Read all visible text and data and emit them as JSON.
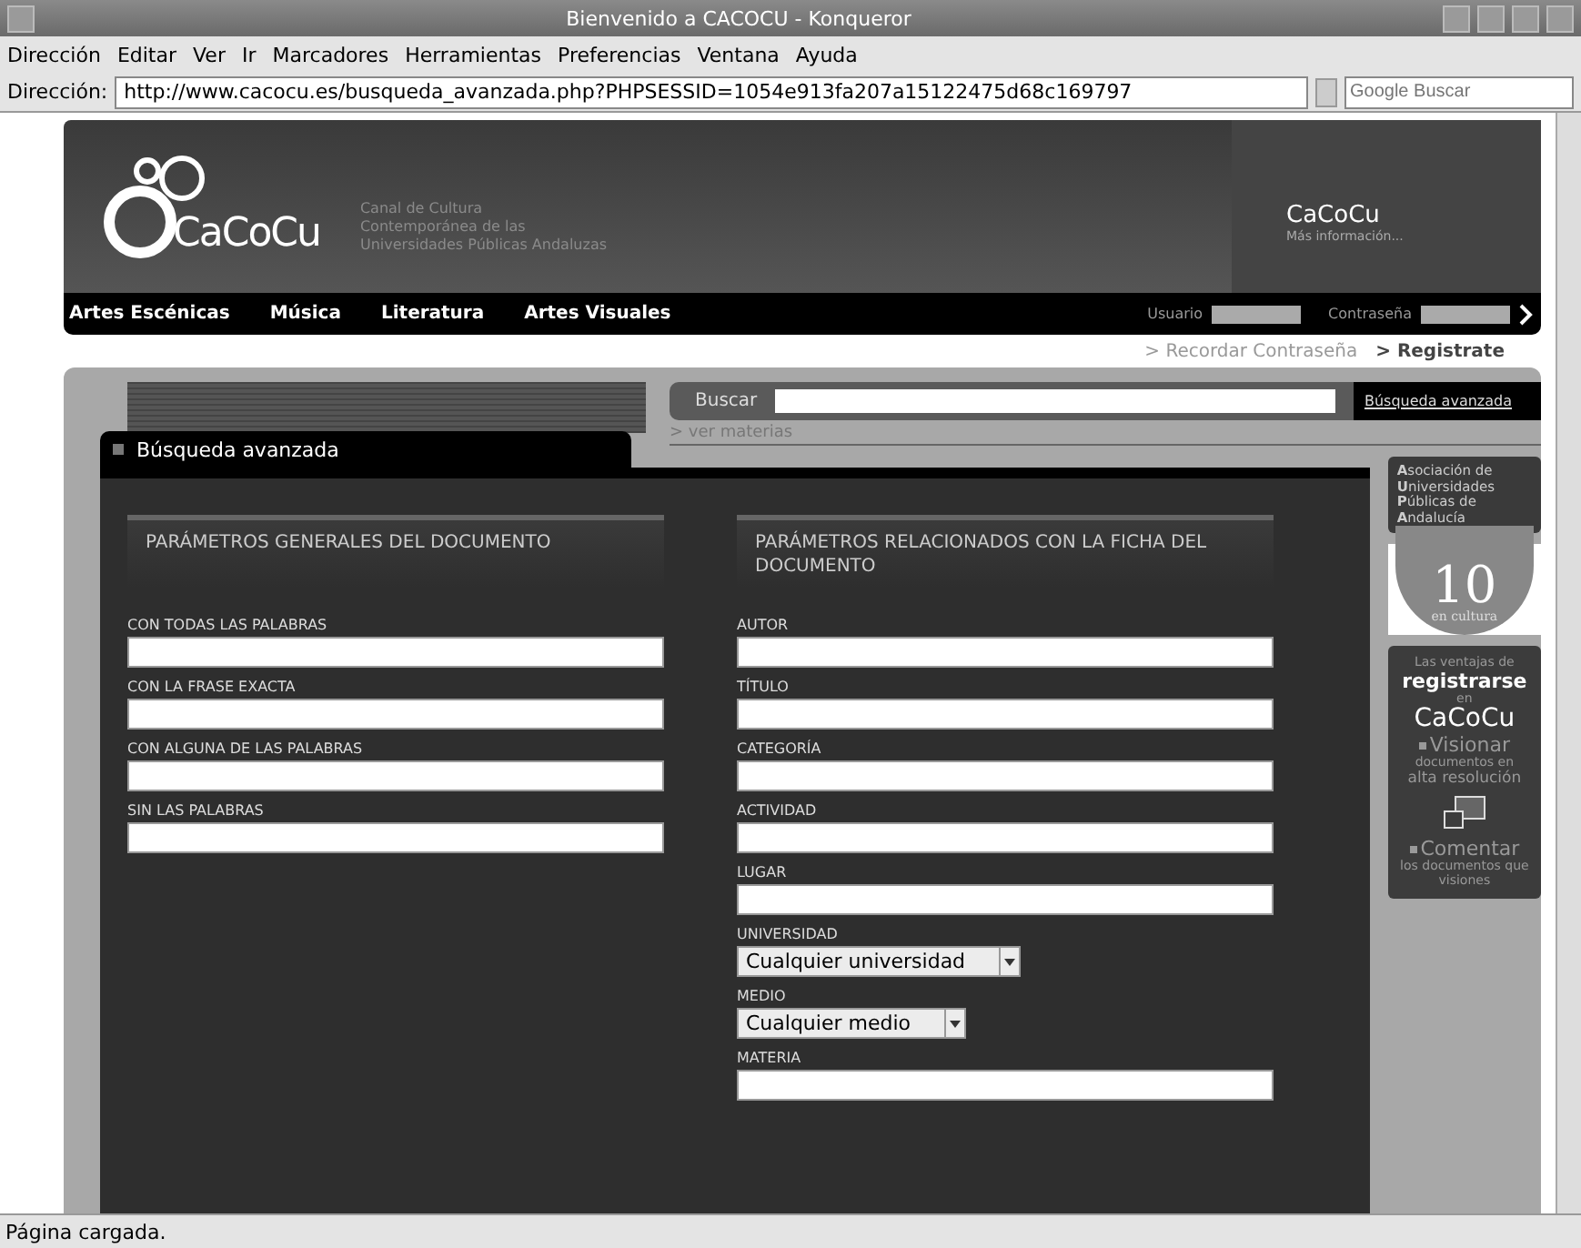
{
  "window": {
    "title": "Bienvenido a CACOCU - Konqueror"
  },
  "menu": [
    "Dirección",
    "Editar",
    "Ver",
    "Ir",
    "Marcadores",
    "Herramientas",
    "Preferencias",
    "Ventana",
    "Ayuda"
  ],
  "address_bar": {
    "label": "Dirección:",
    "url": "http://www.cacocu.es/busqueda_avanzada.php?PHPSESSID=1054e913fa207a15122475d68c169797",
    "search_placeholder": "Google Buscar"
  },
  "header": {
    "logo": "CaCoCu",
    "tagline": [
      "Canal de Cultura",
      "Contemporánea de las",
      "Universidades Públicas Andaluzas"
    ],
    "side_logo": "CaCoCu",
    "side_link": "Más información..."
  },
  "nav": [
    "Artes Escénicas",
    "Música",
    "Literatura",
    "Artes Visuales"
  ],
  "login": {
    "user_label": "Usuario",
    "password_label": "Contraseña",
    "links": [
      {
        "text": "> Recordar Contraseña",
        "bold": false
      },
      {
        "text": "> Registrate",
        "bold": true
      }
    ]
  },
  "search": {
    "label": "Buscar",
    "advanced_link": "Búsqueda avanzada",
    "subjects_link": "> ver materias"
  },
  "tab": "Búsqueda avanzada",
  "sections": [
    {
      "title": "PARÁMETROS GENERALES DEL DOCUMENTO",
      "fields": [
        {
          "label": "CON TODAS LAS PALABRAS",
          "kind": "text"
        },
        {
          "label": "CON LA FRASE EXACTA",
          "kind": "text"
        },
        {
          "label": "CON ALGUNA DE LAS PALABRAS",
          "kind": "text"
        },
        {
          "label": "SIN LAS PALABRAS",
          "kind": "text"
        }
      ]
    },
    {
      "title": "PARÁMETROS RELACIONADOS CON LA FICHA DEL DOCUMENTO",
      "fields": [
        {
          "label": "AUTOR",
          "kind": "text"
        },
        {
          "label": "TÍTULO",
          "kind": "text"
        },
        {
          "label": "CATEGORÍA",
          "kind": "text"
        },
        {
          "label": "ACTIVIDAD",
          "kind": "text"
        },
        {
          "label": "LUGAR",
          "kind": "text"
        },
        {
          "label": "UNIVERSIDAD",
          "kind": "select",
          "value": "Cualquier universidad"
        },
        {
          "label": "MEDIO",
          "kind": "select",
          "value": "Cualquier medio"
        },
        {
          "label": "MATERIA",
          "kind": "text"
        }
      ]
    }
  ],
  "sidebar": {
    "association": [
      "**A**sociación de",
      "**U**niversidades",
      "**P**úblicas de",
      "**A**ndalucía"
    ],
    "culture": {
      "number": "10",
      "caption": "en cultura"
    },
    "promo": [
      {
        "kind": "small",
        "text": "Las ventajas de"
      },
      {
        "kind": "big",
        "text": "registrarse"
      },
      {
        "kind": "small",
        "text": "en"
      },
      {
        "kind": "logo",
        "text": "CaCoCu"
      },
      {
        "kind": "bullet",
        "text": "Visionar"
      },
      {
        "kind": "small",
        "text": "documentos en"
      },
      {
        "kind": "medium",
        "text": "alta resolución"
      },
      {
        "kind": "picture"
      },
      {
        "kind": "bullet",
        "text": "Comentar"
      },
      {
        "kind": "small",
        "text": "los documentos que visiones"
      }
    ]
  },
  "status_bar": "Página cargada."
}
